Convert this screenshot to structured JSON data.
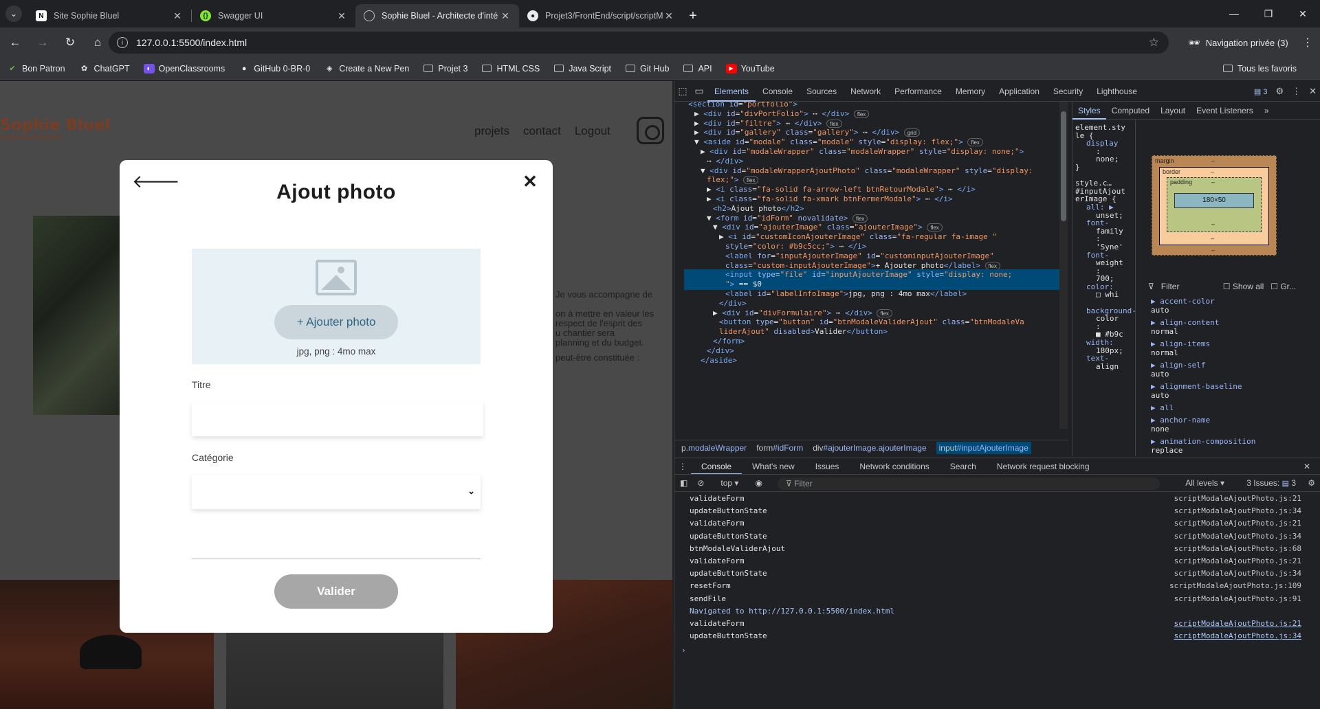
{
  "browser": {
    "tabs": [
      {
        "title": "Site Sophie Bluel",
        "icon": "notion-icon",
        "active": false
      },
      {
        "title": "Swagger UI",
        "icon": "swagger-icon",
        "active": false
      },
      {
        "title": "Sophie Bluel - Architecte d'inté",
        "icon": "globe-icon",
        "active": true
      },
      {
        "title": "Projet3/FrontEnd/script/scriptM",
        "icon": "github-icon",
        "active": false
      }
    ],
    "url": "127.0.0.1:5500/index.html",
    "incognito_label": "Navigation privée (3)",
    "bookmarks": [
      {
        "label": "Bon Patron",
        "icon": "bonpatron-icon"
      },
      {
        "label": "ChatGPT",
        "icon": "chatgpt-icon"
      },
      {
        "label": "OpenClassrooms",
        "icon": "openclassrooms-icon"
      },
      {
        "label": "GitHub 0-BR-0",
        "icon": "github-icon"
      },
      {
        "label": "Create a New Pen",
        "icon": "codepen-icon"
      },
      {
        "label": "Projet 3",
        "icon": "folder-icon"
      },
      {
        "label": "HTML CSS",
        "icon": "folder-icon"
      },
      {
        "label": "Java Script",
        "icon": "folder-icon"
      },
      {
        "label": "Git Hub",
        "icon": "folder-icon"
      },
      {
        "label": "API",
        "icon": "folder-icon"
      },
      {
        "label": "YouTube",
        "icon": "youtube-icon"
      }
    ],
    "all_bookmarks_label": "Tous les favoris"
  },
  "site": {
    "logo_title": "Sophie Bluel",
    "logo_subtitle": "Architecte d'intérieur",
    "nav": [
      "projets",
      "contact",
      "Logout"
    ],
    "bio_lines": [
      "Je vous accompagne de",
      "on à mettre en valeur les",
      "respect de l'esprit des",
      "u chantier sera",
      "planning et du budget.",
      "peut-être constituée :"
    ]
  },
  "modal": {
    "title": "Ajout photo",
    "add_photo_label": "+ Ajouter photo",
    "file_info": "jpg, png : 4mo max",
    "title_label": "Titre",
    "title_value": "",
    "category_label": "Catégorie",
    "category_value": "",
    "validate_label": "Valider"
  },
  "devtools": {
    "tabs": [
      "Elements",
      "Console",
      "Sources",
      "Network",
      "Performance",
      "Memory",
      "Application",
      "Security",
      "Lighthouse"
    ],
    "issues_badge": "3",
    "dom_lines": [
      {
        "indent": 0,
        "html": "<span class='tag'>&lt;section</span> <span class='aname'>id</span>=<span class='aval'>\"portfolio\"</span><span class='tag'>&gt;</span>"
      },
      {
        "indent": 1,
        "html": "▶ <span class='tag'>&lt;div</span> <span class='aname'>id</span>=<span class='aval'>\"divPortFolio\"</span><span class='tag'>&gt;</span> ⋯ <span class='tag'>&lt;/div&gt;</span> <span class='pill'>flex</span>"
      },
      {
        "indent": 1,
        "html": "▶ <span class='tag'>&lt;div</span> <span class='aname'>id</span>=<span class='aval'>\"filtre\"</span><span class='tag'>&gt;</span> ⋯ <span class='tag'>&lt;/div&gt;</span> <span class='pill'>flex</span>"
      },
      {
        "indent": 1,
        "html": "▶ <span class='tag'>&lt;div</span> <span class='aname'>id</span>=<span class='aval'>\"gallery\"</span> <span class='aname'>class</span>=<span class='aval'>\"gallery\"</span><span class='tag'>&gt;</span> ⋯ <span class='tag'>&lt;/div&gt;</span> <span class='pill'>grid</span>"
      },
      {
        "indent": 1,
        "html": "▼ <span class='tag'>&lt;aside</span> <span class='aname'>id</span>=<span class='aval'>\"modale\"</span> <span class='aname'>class</span>=<span class='aval'>\"modale\"</span> <span class='aname'>style</span>=<span class='aval'>\"display: flex;\"</span><span class='tag'>&gt;</span> <span class='pill'>flex</span>"
      },
      {
        "indent": 2,
        "html": "▶ <span class='tag'>&lt;div</span> <span class='aname'>id</span>=<span class='aval'>\"modaleWrapper\"</span> <span class='aname'>class</span>=<span class='aval'>\"modaleWrapper\"</span> <span class='aname'>style</span>=<span class='aval'>\"display: none;\"</span><span class='tag'>&gt;</span>"
      },
      {
        "indent": 3,
        "html": "⋯ <span class='tag'>&lt;/div&gt;</span>"
      },
      {
        "indent": 2,
        "html": "▼ <span class='tag'>&lt;div</span> <span class='aname'>id</span>=<span class='aval'>\"modaleWrapperAjoutPhoto\"</span> <span class='aname'>class</span>=<span class='aval'>\"modaleWrapper\"</span> <span class='aname'>style</span>=<span class='aval'>\"display:</span>"
      },
      {
        "indent": 3,
        "html": "<span class='aval'>flex;\"</span><span class='tag'>&gt;</span> <span class='pill'>flex</span>"
      },
      {
        "indent": 3,
        "html": "▶ <span class='tag'>&lt;i</span> <span class='aname'>class</span>=<span class='aval'>\"fa-solid fa-arrow-left btnRetourModale\"</span><span class='tag'>&gt;</span> ⋯ <span class='tag'>&lt;/i&gt;</span>"
      },
      {
        "indent": 3,
        "html": "▶ <span class='tag'>&lt;i</span> <span class='aname'>class</span>=<span class='aval'>\"fa-solid fa-xmark btnFermerModale\"</span><span class='tag'>&gt;</span> ⋯ <span class='tag'>&lt;/i&gt;</span>"
      },
      {
        "indent": 4,
        "html": "<span class='tag'>&lt;h2&gt;</span>Ajout photo<span class='tag'>&lt;/h2&gt;</span>"
      },
      {
        "indent": 3,
        "html": "▼ <span class='tag'>&lt;form</span> <span class='aname'>id</span>=<span class='aval'>\"idForm\"</span> <span class='aname'>novalidate</span><span class='tag'>&gt;</span> <span class='pill'>flex</span>"
      },
      {
        "indent": 4,
        "html": "▼ <span class='tag'>&lt;div</span> <span class='aname'>id</span>=<span class='aval'>\"ajouterImage\"</span> <span class='aname'>class</span>=<span class='aval'>\"ajouterImage\"</span><span class='tag'>&gt;</span> <span class='pill'>flex</span>"
      },
      {
        "indent": 5,
        "html": "▶ <span class='tag'>&lt;i</span> <span class='aname'>id</span>=<span class='aval'>\"customIconAjouterImage\"</span> <span class='aname'>class</span>=<span class='aval'>\"fa-regular fa-image \"</span>"
      },
      {
        "indent": 6,
        "html": "<span class='aname'>style</span>=<span class='aval'>\"color: #b9c5cc;\"</span><span class='tag'>&gt;</span> ⋯ <span class='tag'>&lt;/i&gt;</span>"
      },
      {
        "indent": 6,
        "html": "<span class='tag'>&lt;label</span> <span class='aname'>for</span>=<span class='aval'>\"inputAjouterImage\"</span> <span class='aname'>id</span>=<span class='aval'>\"custominputAjouterImage\"</span>"
      },
      {
        "indent": 6,
        "html": "<span class='aname'>class</span>=<span class='aval'>\"custom-inputAjouterImage\"</span><span class='tag'>&gt;</span>+ Ajouter photo<span class='tag'>&lt;/label&gt;</span> <span class='pill'>flex</span>"
      },
      {
        "indent": 6,
        "html": "<span class='tag'>&lt;input</span> <span class='aname'>type</span>=<span class='aval'>\"file\"</span> <span class='aname'>id</span>=<span class='aval'>\"inputAjouterImage\"</span> <span class='aname'>style</span>=<span class='aval'>\"display: none;</span>"
      },
      {
        "indent": 6,
        "html": "<span class='aval'>\"</span><span class='tag'>&gt;</span> == $0"
      },
      {
        "indent": 6,
        "html": "<span class='tag'>&lt;label</span> <span class='aname'>id</span>=<span class='aval'>\"labelInfoImage\"</span><span class='tag'>&gt;</span>jpg, png : 4mo max<span class='tag'>&lt;/label&gt;</span>"
      },
      {
        "indent": 5,
        "html": "<span class='tag'>&lt;/div&gt;</span>"
      },
      {
        "indent": 4,
        "html": "▶ <span class='tag'>&lt;div</span> <span class='aname'>id</span>=<span class='aval'>\"divFormulaire\"</span><span class='tag'>&gt;</span> ⋯ <span class='tag'>&lt;/div&gt;</span> <span class='pill'>flex</span>"
      },
      {
        "indent": 5,
        "html": "<span class='tag'>&lt;button</span> <span class='aname'>type</span>=<span class='aval'>\"button\"</span> <span class='aname'>id</span>=<span class='aval'>\"btnModaleValiderAjout\"</span> <span class='aname'>class</span>=<span class='aval'>\"btnModaleVa</span>"
      },
      {
        "indent": 5,
        "html": "<span class='aval'>liderAjout\"</span> <span class='aname'>disabled</span><span class='tag'>&gt;</span>Valider<span class='tag'>&lt;/button&gt;</span>"
      },
      {
        "indent": 4,
        "html": "<span class='tag'>&lt;/form&gt;</span>"
      },
      {
        "indent": 3,
        "html": "<span class='tag'>&lt;/div&gt;</span>"
      },
      {
        "indent": 2,
        "html": "<span class='tag'>&lt;/aside&gt;</span>"
      }
    ],
    "breadcrumbs": [
      {
        "tag": "p",
        "cls": ".modaleWrapper"
      },
      {
        "tag": "form",
        "cls": "#idForm"
      },
      {
        "tag": "div",
        "cls": "#ajouterImage.ajouterImage"
      },
      {
        "tag": "input",
        "cls": "#inputAjouterImage"
      }
    ],
    "styles_tabs": [
      "Styles",
      "Computed",
      "Layout",
      "Event Listeners"
    ],
    "style_rules": [
      {
        "cls": "sel",
        "text": "element.sty"
      },
      {
        "cls": "sel",
        "text": "le {"
      },
      {
        "cls": "prop",
        "text": "display"
      },
      {
        "cls": "val",
        "text": ":"
      },
      {
        "cls": "val",
        "text": "none;"
      },
      {
        "cls": "sel",
        "text": "}"
      },
      {
        "cls": "sel",
        "text": ""
      },
      {
        "cls": "sel",
        "text": "  style.c…"
      },
      {
        "cls": "sel",
        "text": "#inputAjout"
      },
      {
        "cls": "sel",
        "text": "erImage {"
      },
      {
        "cls": "prop",
        "text": "all: ▶"
      },
      {
        "cls": "val",
        "text": "unset;"
      },
      {
        "cls": "prop",
        "text": "font-"
      },
      {
        "cls": "val",
        "text": "family"
      },
      {
        "cls": "val",
        "text": ":"
      },
      {
        "cls": "val",
        "text": "'Syne'"
      },
      {
        "cls": "prop",
        "text": "font-"
      },
      {
        "cls": "val",
        "text": "weight"
      },
      {
        "cls": "val",
        "text": ":"
      },
      {
        "cls": "val",
        "text": "700;"
      },
      {
        "cls": "prop",
        "text": "color:"
      },
      {
        "cls": "val",
        "text": "□ whi"
      },
      {
        "cls": "sel",
        "text": ""
      },
      {
        "cls": "prop",
        "text": "background-"
      },
      {
        "cls": "val",
        "text": "color"
      },
      {
        "cls": "val",
        "text": ":"
      },
      {
        "cls": "val",
        "text": "■ #b9c"
      },
      {
        "cls": "prop",
        "text": "width:"
      },
      {
        "cls": "val",
        "text": "180px;"
      },
      {
        "cls": "prop",
        "text": "text-"
      },
      {
        "cls": "val",
        "text": "align"
      }
    ],
    "box_model": {
      "margin": "margin",
      "border": "border",
      "padding": "padding",
      "content": "180×50",
      "dash": "–"
    },
    "computed_filter_placeholder": "Filter",
    "show_all_label": "Show all",
    "group_label": "Gr...",
    "computed_props": [
      {
        "name": "accent-color",
        "value": "auto"
      },
      {
        "name": "align-content",
        "value": "normal"
      },
      {
        "name": "align-items",
        "value": "normal"
      },
      {
        "name": "align-self",
        "value": "auto"
      },
      {
        "name": "alignment-baseline",
        "value": "auto"
      },
      {
        "name": "all",
        "value": ""
      },
      {
        "name": "anchor-name",
        "value": "none"
      },
      {
        "name": "animation-composition",
        "value": "replace"
      }
    ],
    "console_tabs": [
      "Console",
      "What's new",
      "Issues",
      "Network conditions",
      "Search",
      "Network request blocking"
    ],
    "console_context": "top",
    "console_filter": "Filter",
    "levels_label": "All levels",
    "issues_label": "3 Issues:",
    "issues_count": "3",
    "logs": [
      {
        "msg": "validateForm",
        "src": "scriptModaleAjoutPhoto.js:21",
        "link": false
      },
      {
        "msg": "updateButtonState",
        "src": "scriptModaleAjoutPhoto.js:34",
        "link": false
      },
      {
        "msg": "validateForm",
        "src": "scriptModaleAjoutPhoto.js:21",
        "link": false
      },
      {
        "msg": "updateButtonState",
        "src": "scriptModaleAjoutPhoto.js:34",
        "link": false
      },
      {
        "msg": "btnModaleValiderAjout",
        "src": "scriptModaleAjoutPhoto.js:68",
        "link": false
      },
      {
        "msg": "validateForm",
        "src": "scriptModaleAjoutPhoto.js:21",
        "link": false
      },
      {
        "msg": "updateButtonState",
        "src": "scriptModaleAjoutPhoto.js:34",
        "link": false
      },
      {
        "msg": "resetForm",
        "src": "scriptModaleAjoutPhoto.js:109",
        "link": false
      },
      {
        "msg": "sendFile",
        "src": "scriptModaleAjoutPhoto.js:91",
        "link": false
      },
      {
        "msg": "Navigated to http://127.0.0.1:5500/index.html",
        "src": "",
        "link": false,
        "nav": true
      },
      {
        "msg": "validateForm",
        "src": "scriptModaleAjoutPhoto.js:21",
        "link": true
      },
      {
        "msg": "updateButtonState",
        "src": "scriptModaleAjoutPhoto.js:34",
        "link": true
      }
    ],
    "prompt": "›"
  }
}
